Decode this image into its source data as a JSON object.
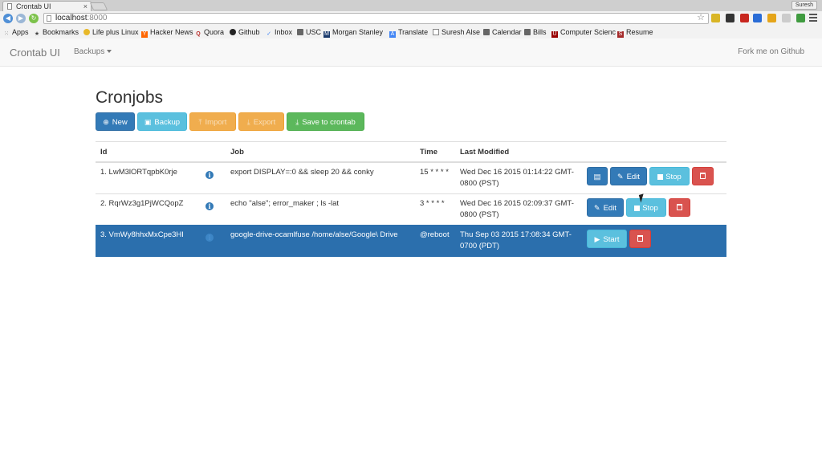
{
  "browser": {
    "tab_title": "Crontab UI",
    "tab_close": "×",
    "user_name": "Suresh",
    "url_host": "localhost",
    "url_port": ":8000",
    "bookmarks": [
      "Apps",
      "Bookmarks",
      "Life plus Linux",
      "Hacker News",
      "Quora",
      "Github",
      "Inbox",
      "USC",
      "Morgan Stanley",
      "Translate",
      "Suresh Alse",
      "Calendar",
      "Bills",
      "Computer Scienc",
      "Resume"
    ]
  },
  "navbar": {
    "brand": "Crontab UI",
    "backups_label": "Backups",
    "fork_label": "Fork me on Github"
  },
  "page": {
    "title": "Cronjobs",
    "buttons": {
      "new": "New",
      "backup": "Backup",
      "import": "Import",
      "export": "Export",
      "save": "Save to crontab"
    }
  },
  "table": {
    "headers": {
      "id": "Id",
      "job": "Job",
      "time": "Time",
      "modified": "Last Modified"
    },
    "rows": [
      {
        "id": "1. LwM3lORTqpbK0rje",
        "job": "export DISPLAY=:0 && sleep 20 && conky",
        "time": "15 * * * *",
        "modified": "Wed Dec 16 2015 01:14:22 GMT-0800 (PST)",
        "edit": "Edit",
        "toggle": "Stop"
      },
      {
        "id": "2. RqrWz3g1PjWCQopZ",
        "job": "echo \"alse\"; error_maker ; ls -lat",
        "time": "3 * * * *",
        "modified": "Wed Dec 16 2015 02:09:37 GMT-0800 (PST)",
        "edit": "Edit",
        "toggle": "Stop"
      },
      {
        "id": "3. VmWy8hhxMxCpe3HI",
        "job": "google-drive-ocamlfuse /home/alse/Google\\ Drive",
        "time": "@reboot",
        "modified": "Thu Sep 03 2015 17:08:34 GMT-0700 (PDT)",
        "toggle": "Start"
      }
    ]
  },
  "colors": {
    "primary": "#337ab7",
    "info": "#5bc0de",
    "warning": "#f0ad4e",
    "success": "#5cb85c",
    "danger": "#d9534f",
    "selected_row": "#2b6fad"
  },
  "icons": [
    "page-icon",
    "back-icon",
    "forward-icon",
    "reload-icon",
    "star-icon",
    "menu-icon",
    "apps-grid-icon",
    "star-bookmark-icon",
    "folder-icon",
    "plus-circle-icon",
    "floppy-icon",
    "upload-icon",
    "download-icon",
    "info-icon",
    "log-icon",
    "edit-icon",
    "stop-icon",
    "play-icon",
    "trash-icon",
    "caret-down-icon"
  ]
}
